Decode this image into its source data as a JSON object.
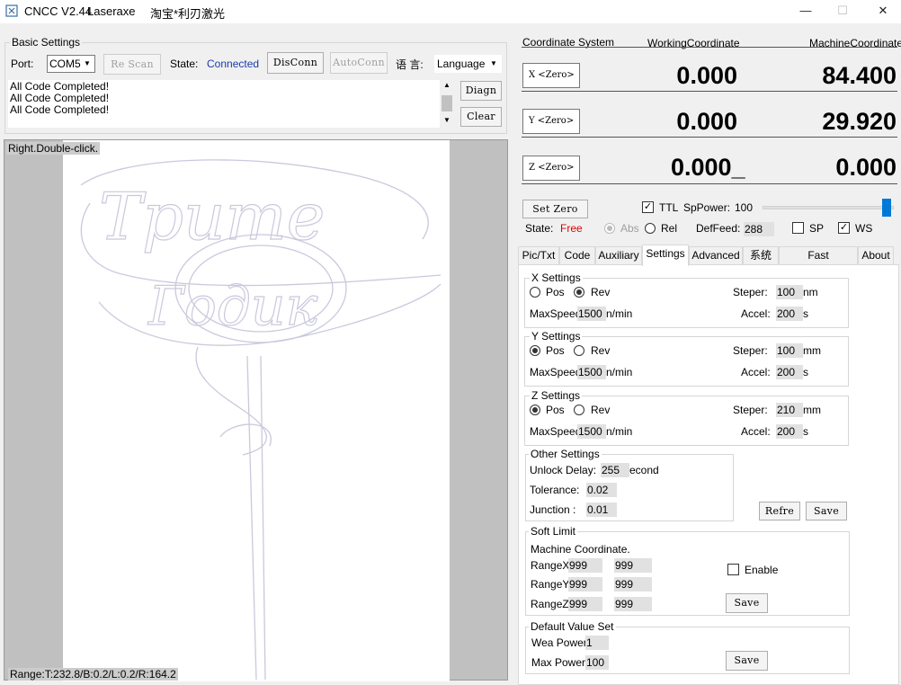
{
  "window": {
    "app_title": "CNCC V2.44",
    "subtitle": "Laseraxe",
    "vendor": "淘宝*利刃激光",
    "minimize": "—",
    "maximize": "☐",
    "close": "✕"
  },
  "basic": {
    "group_label": "Basic Settings",
    "port_label": "Port:",
    "port_value": "COM5",
    "rescan": "Re Scan",
    "state_label": "State:",
    "state_value": "Connected",
    "disconn": "DisConn",
    "autoconn": "AutoConn",
    "lang_label": "语 言:",
    "lang_value": "Language",
    "log": [
      "All Code Completed!",
      "All Code Completed!",
      "All Code Completed!"
    ],
    "diagn": "Diagn",
    "clear": "Clear"
  },
  "canvas": {
    "hint": "Right.Double-click.",
    "range": "Range:T:232.8/B:0.2/L:0.2/R:164.2",
    "artwork_lines": [
      "Трите",
      "Годик"
    ]
  },
  "coords": {
    "header_system": "Coordinate System",
    "header_working": "WorkingCoordinate",
    "header_machine": "MachineCoordinate",
    "rows": [
      {
        "zero": "X <Zero>",
        "working": "0.000",
        "machine": "84.400"
      },
      {
        "zero": "Y <Zero>",
        "working": "0.000",
        "machine": "29.920"
      },
      {
        "zero": "Z <Zero>",
        "working": "0.000_",
        "machine": "0.000"
      }
    ]
  },
  "controls": {
    "set_zero": "Set Zero",
    "ttl": "TTL",
    "sp_power_label": "SpPower:",
    "sp_power_value": "100",
    "sp_power_fraction": 1.0,
    "state_label": "State:",
    "state_value": "Free",
    "abs": "Abs",
    "rel": "Rel",
    "deffeed_label": "DefFeed:",
    "deffeed_value": "288",
    "sp": "SP",
    "ws": "WS"
  },
  "tabs": [
    "Pic/Txt",
    "Code",
    "Auxiliary",
    "Settings",
    "Advanced",
    "系统",
    "Fast Processing",
    "About"
  ],
  "settings": {
    "x": {
      "label": "X Settings",
      "pos": "Pos",
      "rev": "Rev",
      "steper_label": "Steper:",
      "steper": "100",
      "steper_unit": "nm",
      "maxspeed_label": "MaxSpeed:",
      "maxspeed": "1500",
      "maxspeed_unit": "n/min",
      "accel_label": "Accel:",
      "accel": "200",
      "accel_unit": "s"
    },
    "y": {
      "label": "Y Settings",
      "pos": "Pos",
      "rev": "Rev",
      "steper_label": "Steper:",
      "steper": "100",
      "steper_unit": "mm",
      "maxspeed_label": "MaxSpeed:",
      "maxspeed": "1500",
      "maxspeed_unit": "n/min",
      "accel_label": "Accel:",
      "accel": "200",
      "accel_unit": "s"
    },
    "z": {
      "label": "Z Settings",
      "pos": "Pos",
      "rev": "Rev",
      "steper_label": "Steper:",
      "steper": "210",
      "steper_unit": "mm",
      "maxspeed_label": "MaxSpeed:",
      "maxspeed": "1500",
      "maxspeed_unit": "n/min",
      "accel_label": "Accel:",
      "accel": "200",
      "accel_unit": "s"
    },
    "other": {
      "label": "Other Settings",
      "unlock_label": "Unlock Delay:",
      "unlock": "255",
      "unlock_unit": "econd",
      "tolerance_label": "Tolerance:",
      "tolerance": "0.02",
      "junction_label": "Junction :",
      "junction": "0.01",
      "refresh": "Refre",
      "save": "Save"
    },
    "soft": {
      "label": "Soft Limit",
      "note": "Machine Coordinate.",
      "rx_label": "RangeX:",
      "rx1": "999",
      "rx2": "999",
      "ry_label": "RangeY:",
      "ry1": "999",
      "ry2": "999",
      "rz_label": "RangeZ:",
      "rz1": "999",
      "rz2": "999",
      "enable": "Enable",
      "save": "Save"
    },
    "defaults": {
      "label": "Default Value Set",
      "wea_label": "Wea Power:",
      "wea": "1",
      "max_label": "Max Power:",
      "max": "100",
      "save": "Save"
    }
  }
}
